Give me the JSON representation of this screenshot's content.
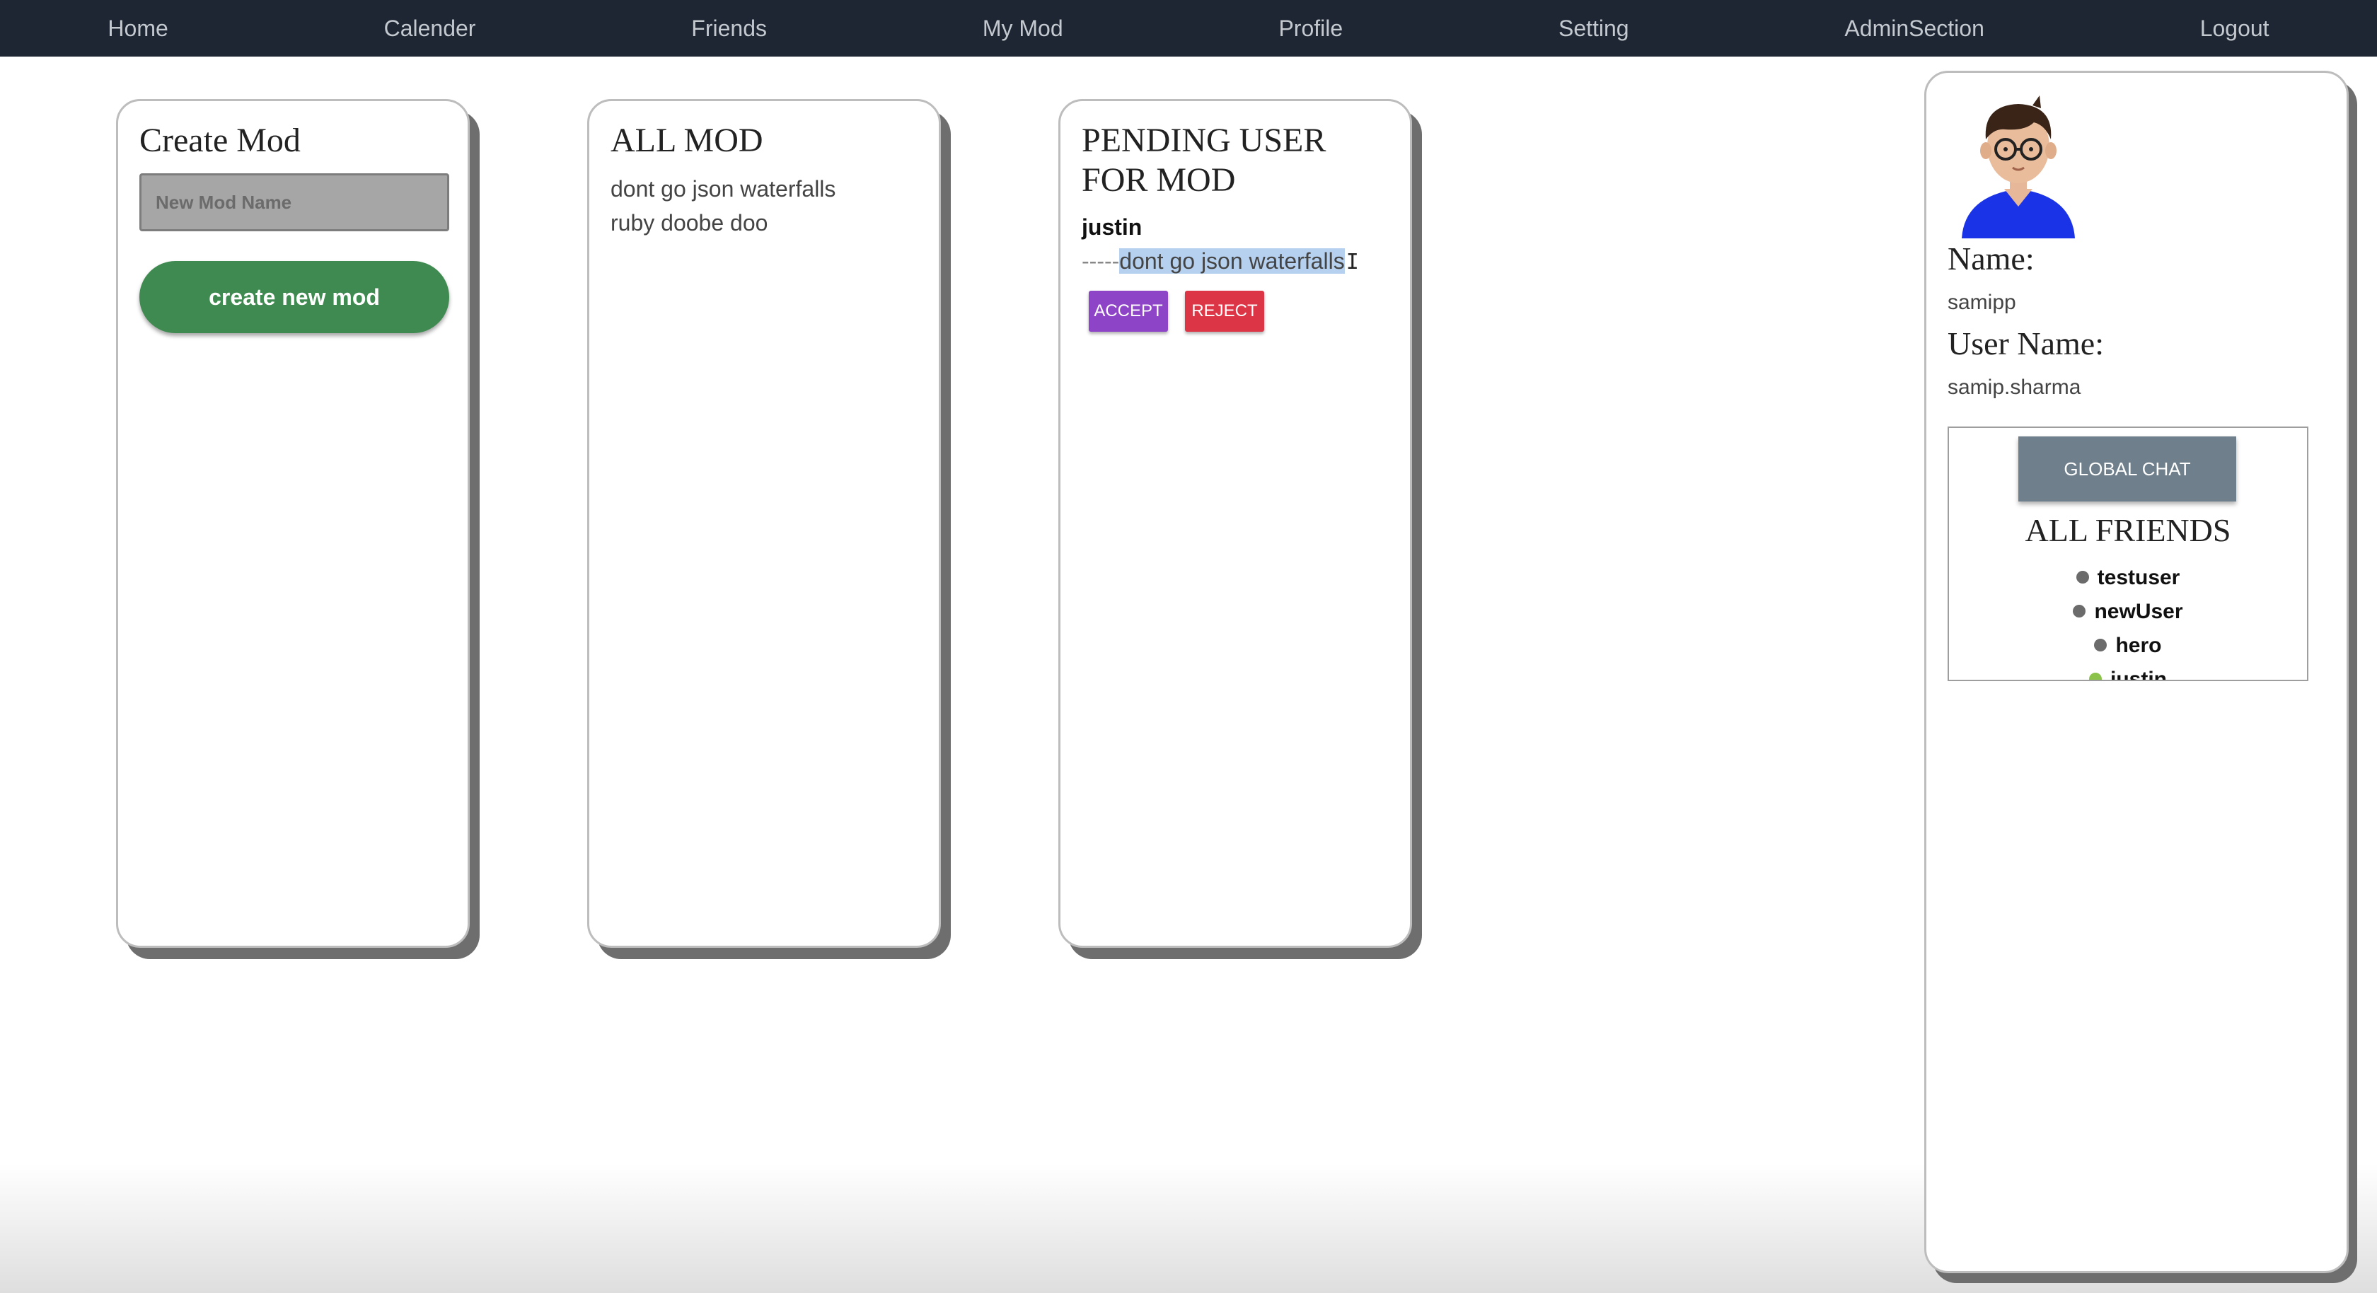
{
  "nav": {
    "items": [
      "Home",
      "Calender",
      "Friends",
      "My Mod",
      "Profile",
      "Setting",
      "AdminSection",
      "Logout"
    ]
  },
  "create_mod": {
    "title": "Create Mod",
    "input_placeholder": "New Mod Name",
    "button_label": "create new mod"
  },
  "all_mod": {
    "title": "ALL MOD",
    "items": [
      "dont go json waterfalls",
      "ruby doobe doo"
    ]
  },
  "pending": {
    "title_line1": "PENDING USER",
    "title_line2": "FOR MOD",
    "user": "justin",
    "prefix": "-----",
    "mod": "dont go json waterfalls",
    "accept_label": "ACCEPT",
    "reject_label": "REJECT"
  },
  "profile": {
    "name_label": "Name:",
    "name_value": "samipp",
    "username_label": "User Name:",
    "username_value": "samip.sharma",
    "global_chat_label": "GLOBAL CHAT",
    "friends_title": "ALL FRIENDS",
    "friends": [
      {
        "name": "testuser",
        "status": "offline"
      },
      {
        "name": "newUser",
        "status": "offline"
      },
      {
        "name": "hero",
        "status": "offline"
      },
      {
        "name": "justin",
        "status": "online"
      }
    ]
  },
  "colors": {
    "nav_bg": "#1e2633",
    "create_button": "#3f8a50",
    "accept_button": "#8e44c6",
    "reject_button": "#dc3545",
    "chat_button": "#6f7f8b",
    "online_dot": "#8bc34a",
    "offline_dot": "#6b6b6b"
  }
}
